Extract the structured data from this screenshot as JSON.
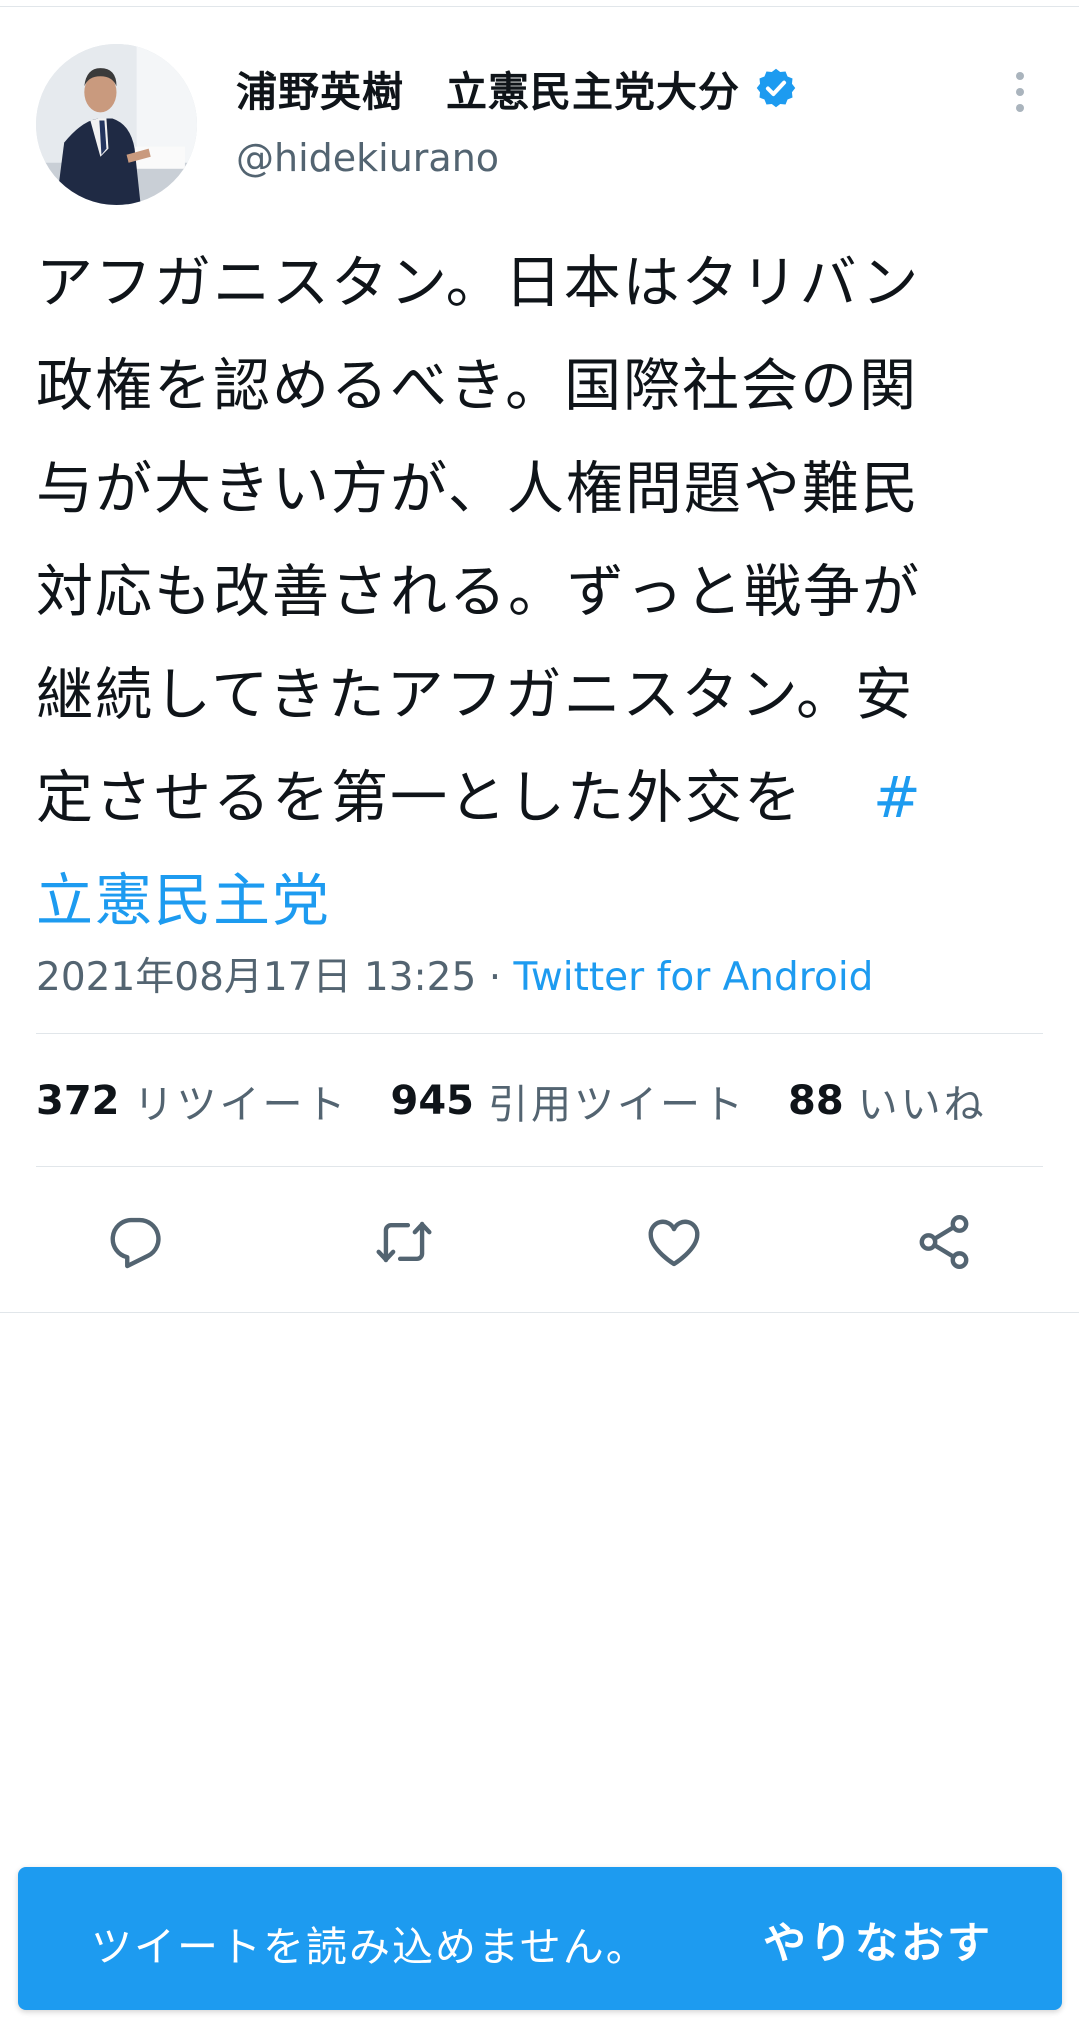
{
  "tweet": {
    "display_name": "浦野英樹　立憲民主党大分",
    "handle": "@hidekiurano",
    "verified": true,
    "text_lines": [
      "アフガニスタン。日本はタリバン",
      "政権を認めるべき。国際社会の関",
      "与が大きい方が、人権問題や難民",
      "対応も改善される。ずっと戦争が",
      "継続してきたアフガニスタン。安",
      "定させるを第一とした外交を"
    ],
    "hashtag_mark": "#",
    "hashtag_text": "立憲民主党",
    "date": "2021年08月17日 13:25",
    "dot": " · ",
    "source": "Twitter for Android"
  },
  "stats": {
    "retweets": {
      "count": "372",
      "label": "リツイート"
    },
    "quotes": {
      "count": "945",
      "label": "引用ツイート"
    },
    "likes": {
      "count": "88",
      "label": "いいね"
    }
  },
  "actions": [
    "reply-icon",
    "retweet-icon",
    "like-icon",
    "share-icon"
  ],
  "toast": {
    "message": "ツイートを読み込めません。",
    "retry_label": "やりなおす"
  },
  "colors": {
    "accent": "#1d9bf0",
    "text": "#0f1419",
    "secondary": "#536471",
    "divider": "#e1e6ea"
  }
}
